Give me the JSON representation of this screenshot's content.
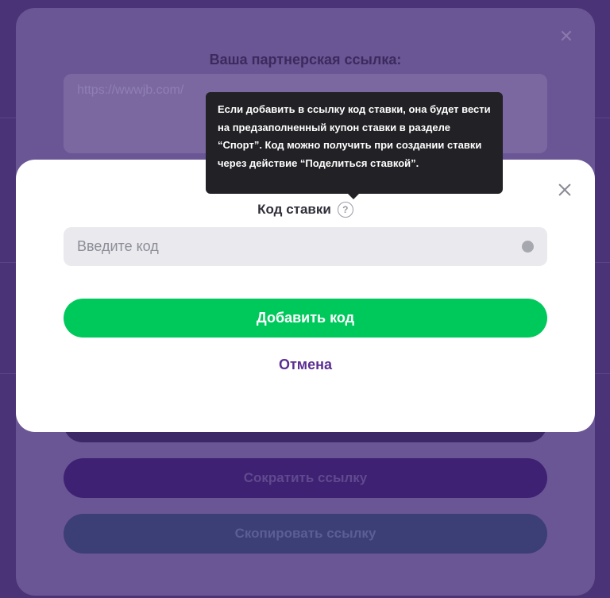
{
  "background_modal": {
    "title": "Ваша партнерская ссылка:",
    "link_value": "https://wwwjb.com/",
    "shorten_button": "Сократить ссылку",
    "copy_button": "Скопировать ссылку"
  },
  "modal": {
    "label": "Код ставки",
    "help_icon_glyph": "?",
    "input": {
      "placeholder": "Введите код",
      "value": ""
    },
    "add_button": "Добавить код",
    "cancel_button": "Отмена",
    "tooltip": "Если добавить в ссылку код ставки, она будет вести на предзаполненный купон ставки в разделе “Спорт”. Код можно получить при создании ставки через действие “Поделиться ставкой”."
  },
  "colors": {
    "accent_green": "#00c95c",
    "accent_purple": "#5b2e92",
    "overlay": "#4b3377",
    "tooltip_bg": "#222226"
  },
  "icons": {
    "close": "close-icon",
    "help": "question-circle-icon",
    "input_indicator": "dot-icon"
  }
}
